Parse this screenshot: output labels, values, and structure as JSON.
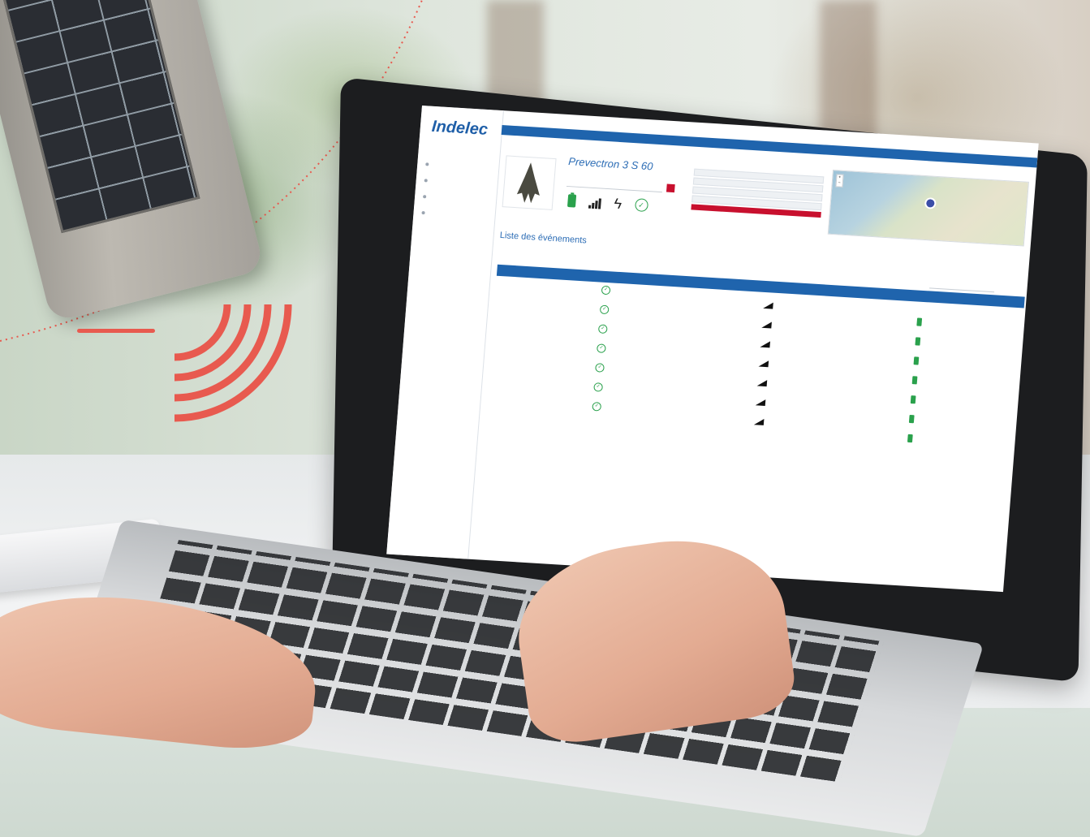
{
  "scene": {
    "description_hidden": "",
    "accent_color": "#e85a4f",
    "primary_blue": "#1f64ad",
    "brand_red": "#c8102e",
    "status_green": "#2aa14c"
  },
  "app": {
    "logo_text": "Indelec",
    "logo_sub": "",
    "logo_tag": "",
    "nav": [
      {
        "label": "",
        "icon": "home-icon"
      },
      {
        "label": "",
        "icon": "device-icon"
      },
      {
        "label": "",
        "icon": "list-icon"
      },
      {
        "label": "",
        "icon": "user-icon"
      }
    ],
    "topbar_label": "",
    "product": {
      "title": "Prevectron 3 S 60",
      "serial": "",
      "input_placeholder": "",
      "status_icons": [
        "battery-icon",
        "signal-icon",
        "lightning-icon",
        "check-icon"
      ]
    },
    "fields": [
      {
        "label": "",
        "value": ""
      },
      {
        "label": "",
        "value": ""
      },
      {
        "label": "",
        "value": ""
      },
      {
        "label": "",
        "value": ""
      },
      {
        "label": "",
        "value": ""
      }
    ],
    "map_credit": "",
    "events_title": "Liste des événements",
    "filter_note": "",
    "table": {
      "headers": [
        "",
        "",
        "",
        ""
      ],
      "rows": [
        {
          "date": ""
        },
        {
          "date": ""
        },
        {
          "date": ""
        },
        {
          "date": ""
        },
        {
          "date": ""
        },
        {
          "date": ""
        },
        {
          "date": ""
        }
      ]
    }
  }
}
